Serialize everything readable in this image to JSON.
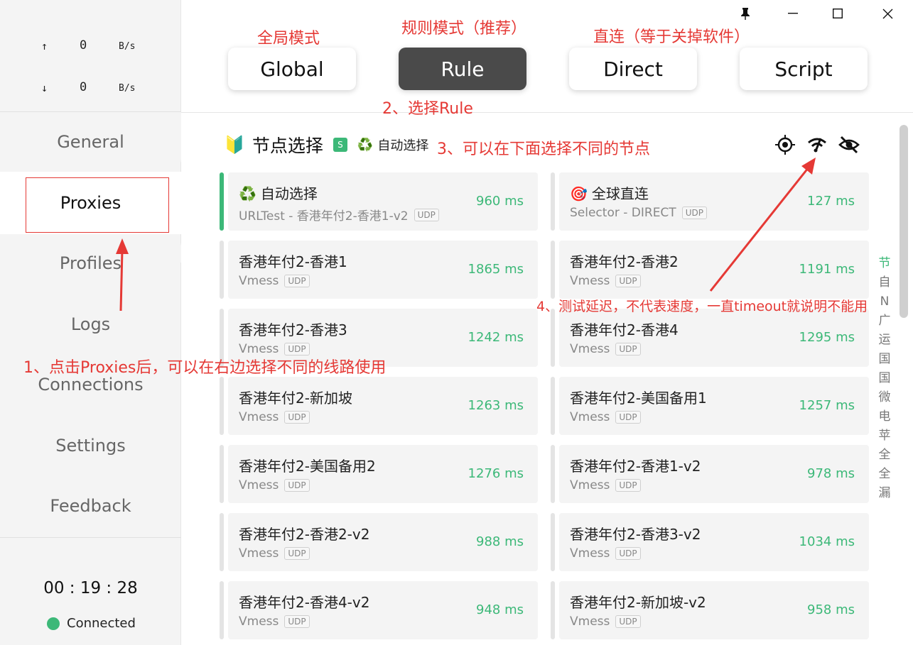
{
  "traffic": {
    "up_arrow": "↑",
    "up_value": "0",
    "up_unit": "B/s",
    "down_arrow": "↓",
    "down_value": "0",
    "down_unit": "B/s"
  },
  "nav": {
    "general": "General",
    "proxies": "Proxies",
    "profiles": "Profiles",
    "logs": "Logs",
    "connections": "Connections",
    "settings": "Settings",
    "feedback": "Feedback"
  },
  "status": {
    "timer": "00 : 19 : 28",
    "label": "Connected"
  },
  "modes": {
    "global": "Global",
    "rule": "Rule",
    "direct": "Direct",
    "script": "Script"
  },
  "group": {
    "icon": "🔰",
    "title": "节点选择",
    "badge": "S",
    "now_icon": "♻️",
    "now": "自动选择"
  },
  "annotations": {
    "global_mode": "全局模式",
    "rule_mode": "规则模式（推荐）",
    "direct_mode": "直连（等于关掉软件）",
    "step2": "2、选择Rule",
    "step3": "3、可以在下面选择不同的节点",
    "step4": "4、测试延迟，不代表速度，一直timeout就说明不能用",
    "step1": "1、点击Proxies后，可以在右边选择不同的线路使用"
  },
  "cards": [
    {
      "icon": "♻️",
      "name": "自动选择",
      "type": "URLTest - 香港年付2-香港1-v2",
      "udp": "UDP",
      "delay": "960 ms",
      "selected": true
    },
    {
      "icon": "🎯",
      "name": "全球直连",
      "type": "Selector - DIRECT",
      "udp": "UDP",
      "delay": "127 ms",
      "selected": false
    },
    {
      "icon": "",
      "name": "香港年付2-香港1",
      "type": "Vmess",
      "udp": "UDP",
      "delay": "1865 ms",
      "selected": false
    },
    {
      "icon": "",
      "name": "香港年付2-香港2",
      "type": "Vmess",
      "udp": "UDP",
      "delay": "1191 ms",
      "selected": false
    },
    {
      "icon": "",
      "name": "香港年付2-香港3",
      "type": "Vmess",
      "udp": "UDP",
      "delay": "1242 ms",
      "selected": false
    },
    {
      "icon": "",
      "name": "香港年付2-香港4",
      "type": "Vmess",
      "udp": "UDP",
      "delay": "1295 ms",
      "selected": false
    },
    {
      "icon": "",
      "name": "香港年付2-新加坡",
      "type": "Vmess",
      "udp": "UDP",
      "delay": "1263 ms",
      "selected": false
    },
    {
      "icon": "",
      "name": "香港年付2-美国备用1",
      "type": "Vmess",
      "udp": "UDP",
      "delay": "1257 ms",
      "selected": false
    },
    {
      "icon": "",
      "name": "香港年付2-美国备用2",
      "type": "Vmess",
      "udp": "UDP",
      "delay": "1276 ms",
      "selected": false
    },
    {
      "icon": "",
      "name": "香港年付2-香港1-v2",
      "type": "Vmess",
      "udp": "UDP",
      "delay": "978 ms",
      "selected": false
    },
    {
      "icon": "",
      "name": "香港年付2-香港2-v2",
      "type": "Vmess",
      "udp": "UDP",
      "delay": "988 ms",
      "selected": false
    },
    {
      "icon": "",
      "name": "香港年付2-香港3-v2",
      "type": "Vmess",
      "udp": "UDP",
      "delay": "1034 ms",
      "selected": false
    },
    {
      "icon": "",
      "name": "香港年付2-香港4-v2",
      "type": "Vmess",
      "udp": "UDP",
      "delay": "948 ms",
      "selected": false
    },
    {
      "icon": "",
      "name": "香港年付2-新加坡-v2",
      "type": "Vmess",
      "udp": "UDP",
      "delay": "958 ms",
      "selected": false
    }
  ],
  "alpha_index": [
    "节",
    "自",
    "N",
    "广",
    "运",
    "国",
    "国",
    "微",
    "电",
    "苹",
    "全",
    "全",
    "漏"
  ],
  "colors": {
    "accent": "#3cb878",
    "annotation": "#e53935",
    "active_mode": "#4a4a4a"
  },
  "icons": {
    "locate": "crosshair-icon",
    "speedtest": "wifi-speed-icon",
    "hide": "eye-off-icon",
    "pin": "pin-icon"
  }
}
